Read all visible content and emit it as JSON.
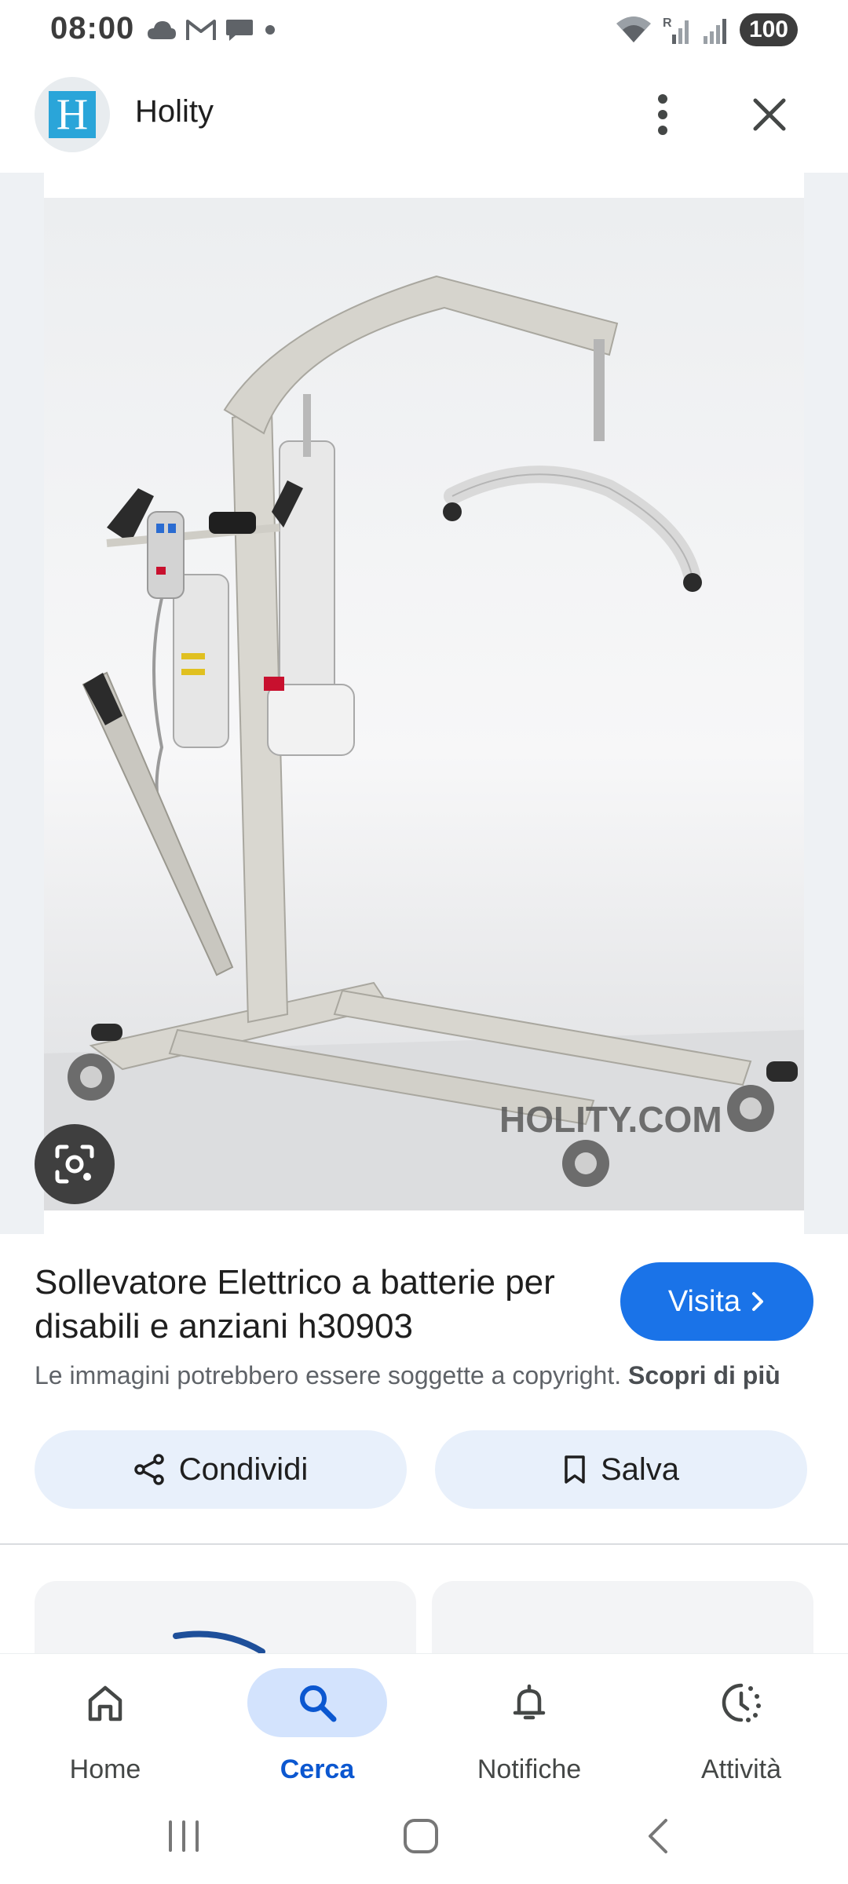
{
  "status_bar": {
    "time": "08:00",
    "battery": "100"
  },
  "header": {
    "logo_letter": "H",
    "site_name": "Holity"
  },
  "image": {
    "watermark": "HOLITY.COM"
  },
  "result": {
    "title": "Sollevatore Elettrico a batterie per disabili e anziani h30903",
    "visit_label": "Visita",
    "copyright_text": "Le immagini potrebbero essere soggette a copyright.",
    "learn_more": "Scopri di più"
  },
  "actions": {
    "share_label": "Condividi",
    "save_label": "Salva"
  },
  "bottom_nav": {
    "items": [
      {
        "label": "Home",
        "icon": "home-icon"
      },
      {
        "label": "Cerca",
        "icon": "search-icon",
        "active": true
      },
      {
        "label": "Notifiche",
        "icon": "bell-icon"
      },
      {
        "label": "Attività",
        "icon": "activity-icon"
      }
    ]
  },
  "colors": {
    "accent": "#1a73e8",
    "active_nav_bg": "#d3e3fd",
    "active_nav_text": "#0b57d0",
    "action_bg": "#e8f0fb"
  }
}
